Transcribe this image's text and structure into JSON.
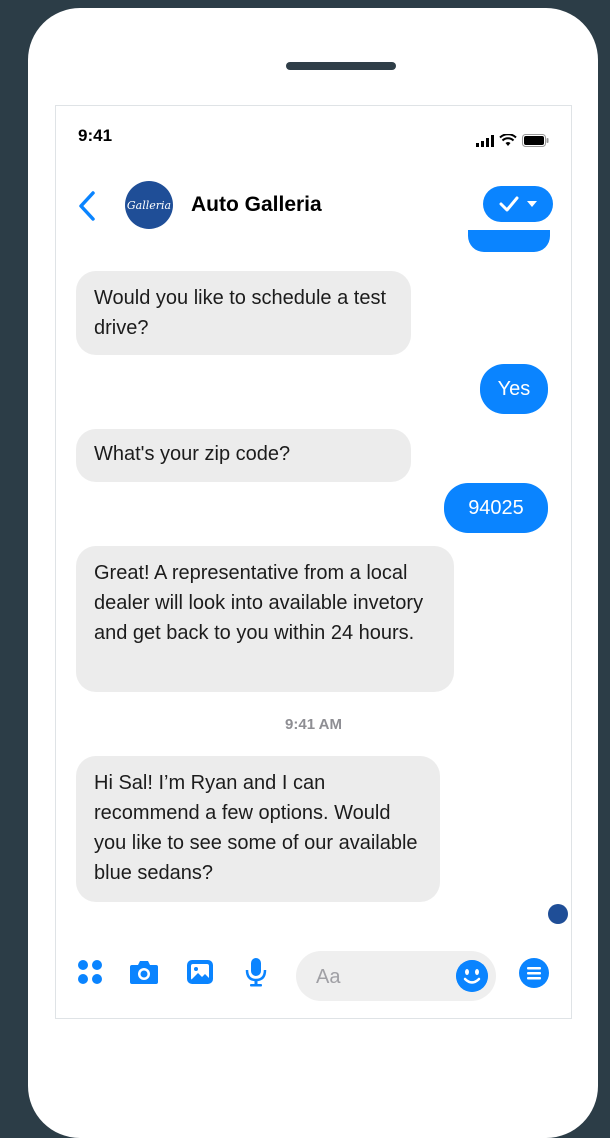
{
  "status_bar": {
    "time": "9:41"
  },
  "header": {
    "title": "Auto Galleria",
    "avatar_text": "Galleria"
  },
  "messages": [
    {
      "from": "business",
      "text": "Would you like to schedule a test drive?"
    },
    {
      "from": "user",
      "text": "Yes"
    },
    {
      "from": "business",
      "text": "What's your zip code?"
    },
    {
      "from": "user",
      "text": "94025"
    },
    {
      "from": "business",
      "text": "Great! A representative from a local dealer will look into available invetory and get back to you within 24 hours."
    },
    {
      "from": "business",
      "text": "Hi Sal! I’m Ryan and I can recommend a few options. Would you like to see some of our available blue sedans?"
    }
  ],
  "timestamp": "9:41 AM",
  "composer": {
    "placeholder": "Aa"
  },
  "colors": {
    "accent": "#0a84ff",
    "background": "#2c3d47",
    "incoming_bubble": "#ececec"
  },
  "icons": [
    "back-chevron-icon",
    "checkmark-icon",
    "menu-dots-icon",
    "camera-icon",
    "photo-icon",
    "microphone-icon",
    "smiley-icon",
    "list-icon"
  ]
}
